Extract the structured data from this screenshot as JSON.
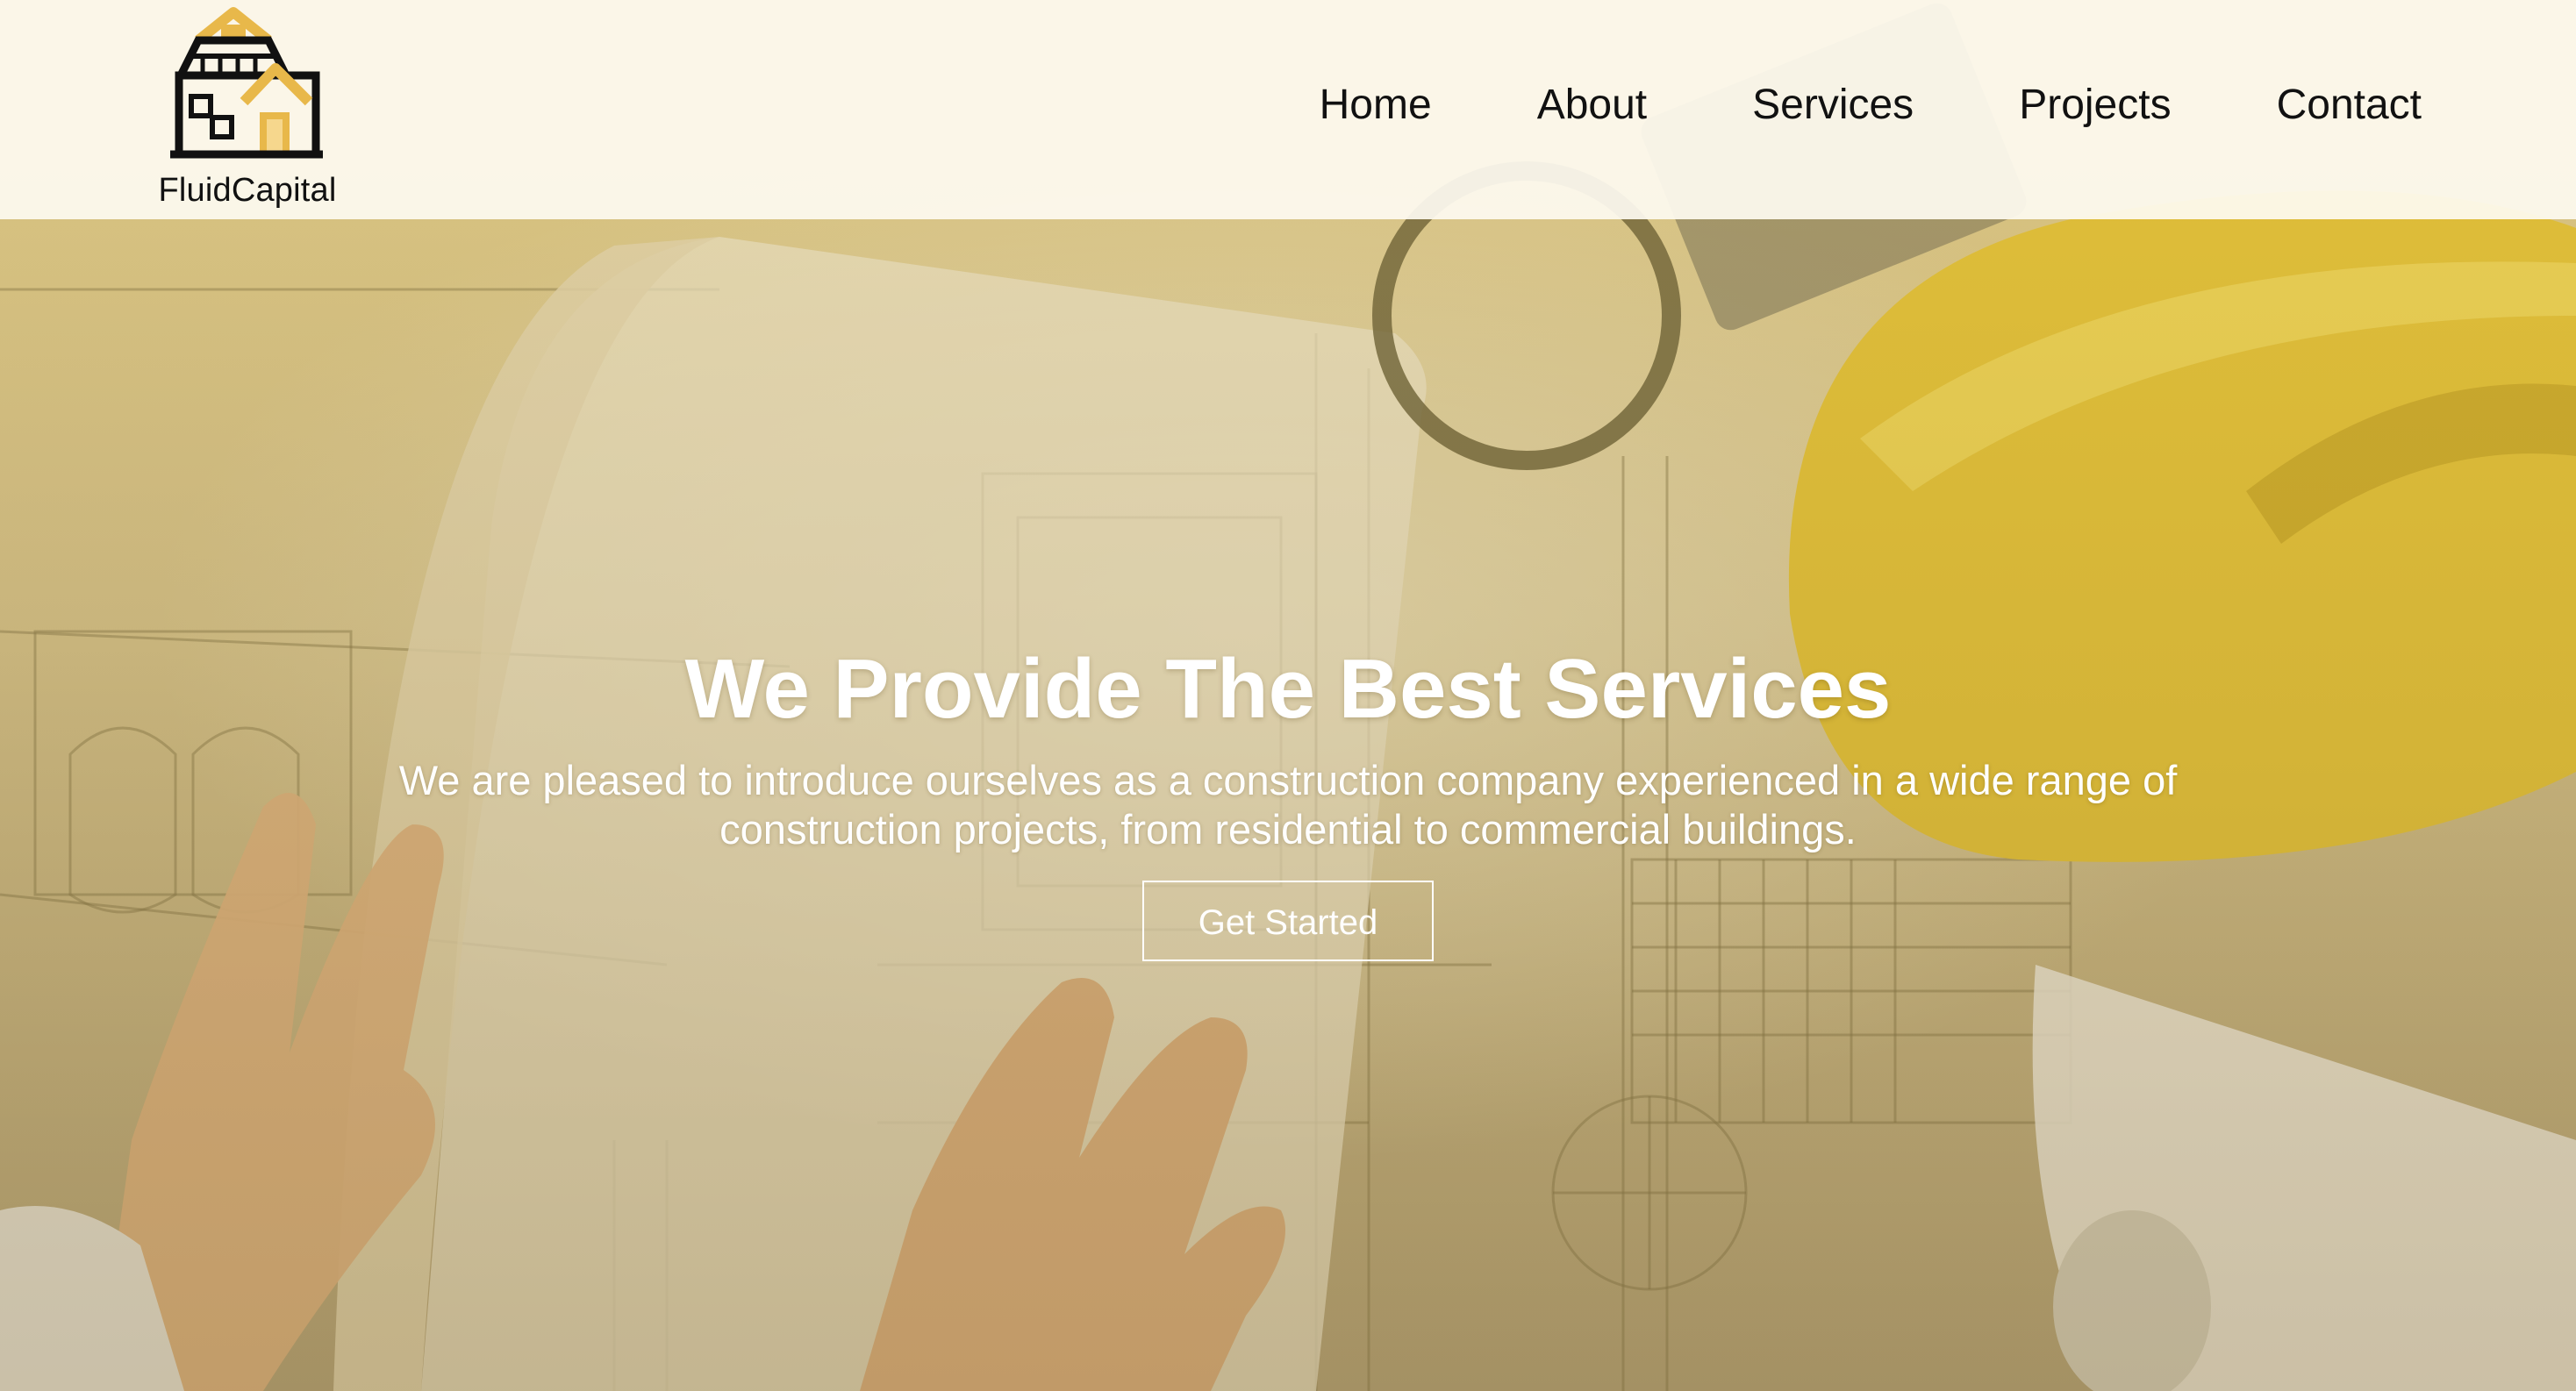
{
  "brand": {
    "name": "FluidCapital",
    "logo_icon": "house-icon"
  },
  "nav": {
    "items": [
      {
        "label": "Home"
      },
      {
        "label": "About"
      },
      {
        "label": "Services"
      },
      {
        "label": "Projects"
      },
      {
        "label": "Contact"
      }
    ]
  },
  "hero": {
    "title": "We Provide The Best Services",
    "subtitle": "We are pleased to introduce ourselves as a construction company experienced in a wide range of construction projects, from residential to commercial buildings.",
    "cta_label": "Get Started",
    "background": "construction-blueprint-image"
  },
  "colors": {
    "accent": "#e8b84a",
    "header_bg": "#fdfaf0",
    "text_dark": "#111111",
    "text_light": "#ffffff"
  }
}
